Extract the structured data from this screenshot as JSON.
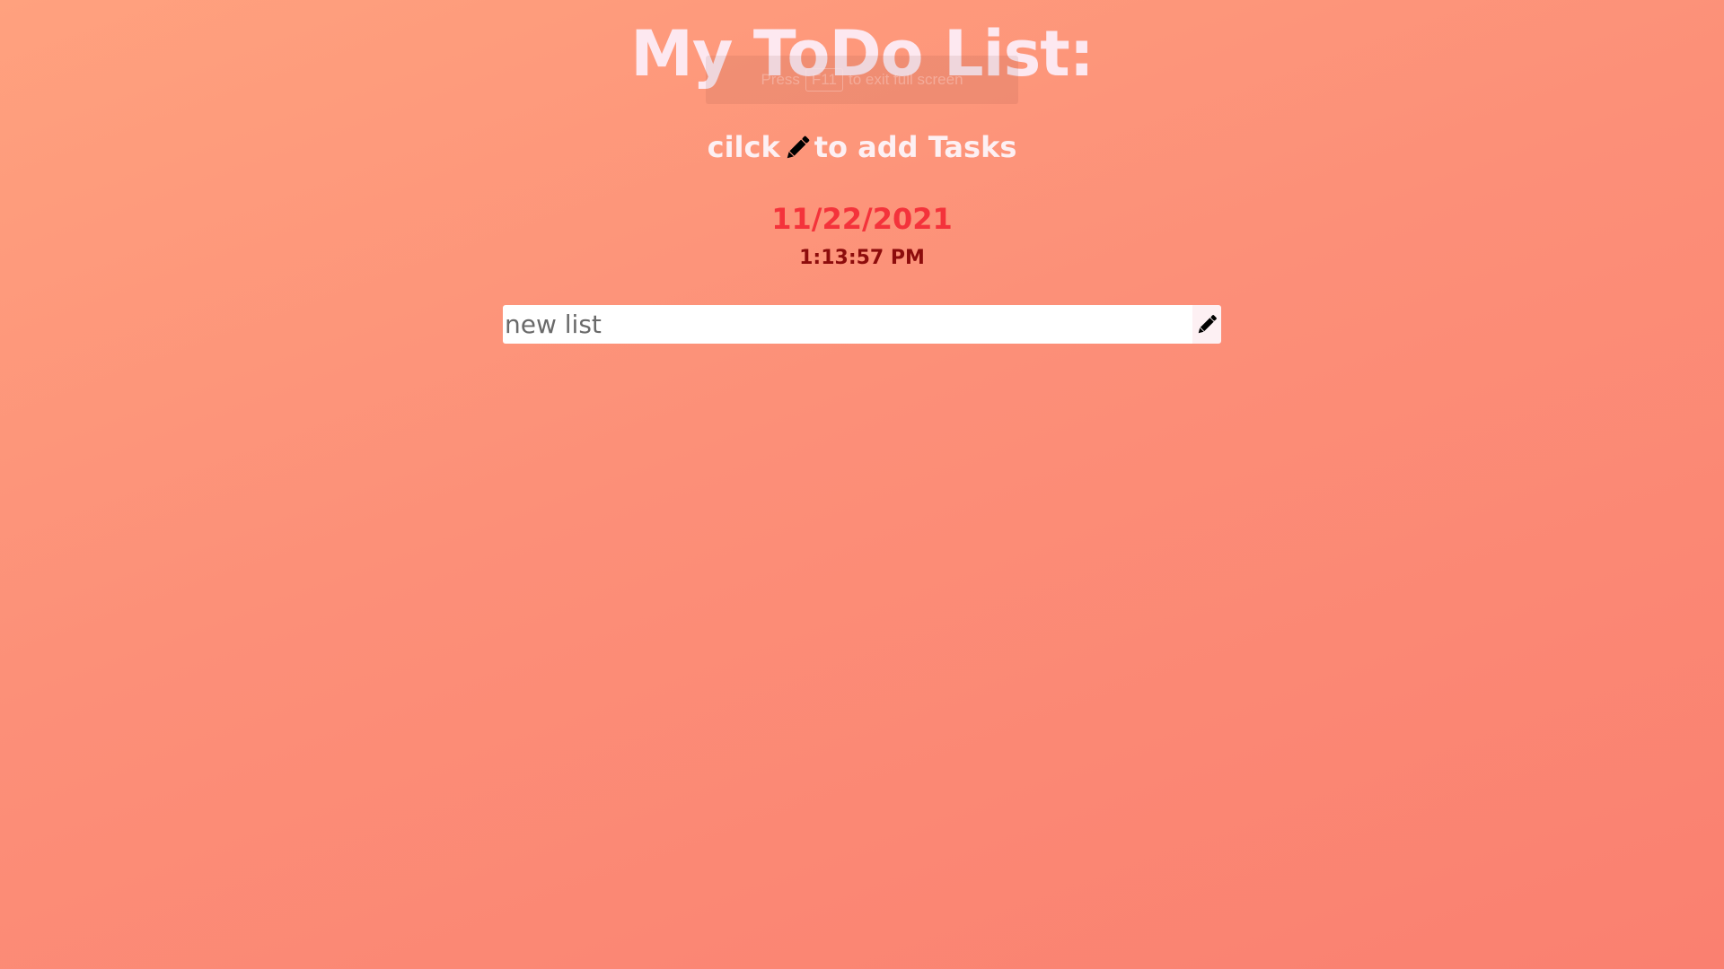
{
  "header": {
    "title": "My ToDo List:",
    "subtitle_before": "cilck",
    "subtitle_after": "to add Tasks"
  },
  "fullscreen_hint": {
    "prefix": "Press",
    "key": "F11",
    "suffix": "to exit full screen"
  },
  "clock": {
    "date": "11/22/2021",
    "time": "1:13:57 PM"
  },
  "task_input": {
    "placeholder": "new list",
    "value": ""
  },
  "colors": {
    "background_start": "#ffa17e",
    "background_end": "#fa8070",
    "title": "#fde8f0",
    "date": "#f4333b",
    "time": "#8d0c0c"
  },
  "icons": {
    "subtitle_icon": "pencil-icon",
    "add_button_icon": "pencil-icon"
  }
}
